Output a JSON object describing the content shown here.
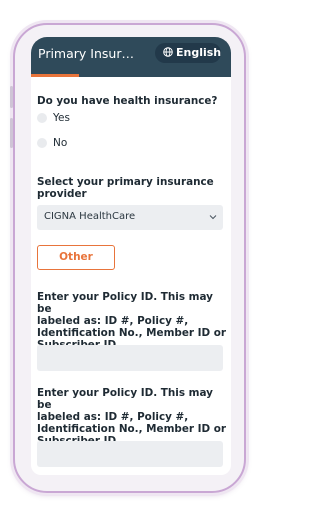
{
  "header": {
    "title": "Primary Insura...",
    "language_label": "English"
  },
  "progress": {
    "fraction": 0.24
  },
  "question_insurance": {
    "label": "Do you have health insurance?",
    "options": [
      "Yes",
      "No"
    ]
  },
  "provider": {
    "label_line1": "Select your primary insurance",
    "label_line2": "provider",
    "selected": "CIGNA HealthCare",
    "other_button": "Other"
  },
  "policy_fields": [
    {
      "line1": "Enter your Policy ID. This may be",
      "line2": "labeled as: ID #, Policy #,",
      "line3": "Identification No., Member ID or",
      "line4": "Subscriber ID.",
      "value": ""
    },
    {
      "line1": "Enter your Policy ID. This may be",
      "line2": "labeled as: ID #, Policy #,",
      "line3": "Identification No., Member ID or",
      "line4": "Subscriber ID.",
      "value": ""
    }
  ],
  "colors": {
    "header_bg": "#2f4a5a",
    "accent": "#e8743b"
  }
}
